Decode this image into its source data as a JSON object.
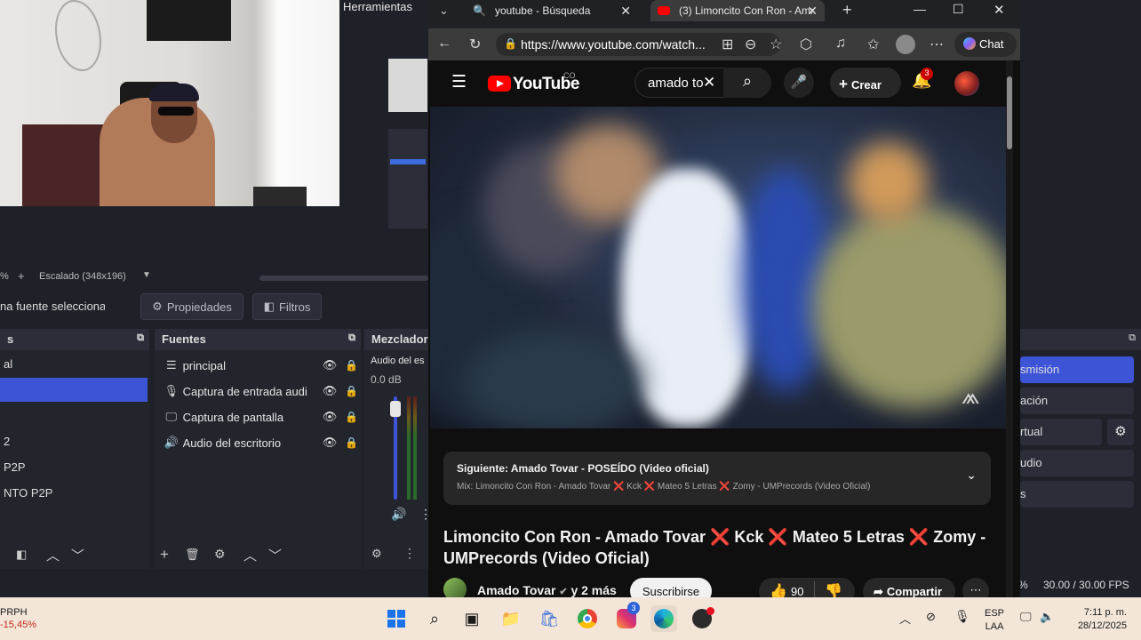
{
  "obs": {
    "menu_tools": "Herramientas",
    "scale_label": "Escalado (348x196)",
    "no_source_selected": "na fuente seleccionad",
    "properties_label": "Propiedades",
    "filters_label": "Filtros",
    "scenes_header": "s",
    "scenes": [
      {
        "label": "al",
        "selected": false
      },
      {
        "label": "",
        "selected": true
      },
      {
        "label": "",
        "selected": false
      },
      {
        "label": "2",
        "selected": false
      },
      {
        "label": "P2P",
        "selected": false
      },
      {
        "label": "NTO P2P",
        "selected": false
      }
    ],
    "sources_header": "Fuentes",
    "sources": [
      {
        "label": "principal",
        "icon": "list-icon"
      },
      {
        "label": "Captura de entrada audi",
        "icon": "microphone-icon"
      },
      {
        "label": "Captura de pantalla",
        "icon": "monitor-icon"
      },
      {
        "label": "Audio del escritorio",
        "icon": "speaker-icon"
      }
    ],
    "mixer_header": "Mezclador",
    "mixer_channel": "Audio del es",
    "mixer_db": "0.0 dB",
    "mixer_level": 0.12,
    "controls": [
      {
        "label": "smisión",
        "highlight": true
      },
      {
        "label": "ación",
        "highlight": false
      },
      {
        "label": "rtual",
        "highlight": false
      },
      {
        "label": "udio",
        "highlight": false
      },
      {
        "label": "s",
        "highlight": false
      }
    ],
    "status_percent": "%",
    "fps": "30.00 / 30.00 FPS"
  },
  "browser": {
    "tabs": [
      {
        "label": "youtube - Búsqueda",
        "active": false
      },
      {
        "label": "(3) Limoncito Con Ron - Ama",
        "active": true
      }
    ],
    "url": "https://www.youtube.com/watch...",
    "chat_label": "Chat"
  },
  "youtube": {
    "logo_text": "YouTube",
    "country_code": "CO",
    "search_value": "amado to",
    "create_label": "Crear",
    "notification_count": "3",
    "up_next_title": "Siguiente: Amado Tovar - POSEÍDO (Video oficial)",
    "up_next_mix": "Mix: Limoncito Con Ron - Amado Tovar ❌ Kck ❌ Mateo 5 Letras ❌ Zomy - UMPrecords (Video Oficial)",
    "video_title": "Limoncito Con Ron - Amado Tovar ❌ Kck ❌ Mateo 5 Letras ❌ Zomy - UMPrecords (Video Oficial)",
    "channel_name": "Amado Tovar",
    "channel_suffix": "y 2 más",
    "subscribe_label": "Suscribirse",
    "likes": "90",
    "share_label": "Compartir"
  },
  "taskbar": {
    "ticker_name": "PRPH",
    "ticker_change": "-15,45%",
    "language_top": "ESP",
    "language_bottom": "LAA",
    "time": "7:11 p. m.",
    "date": "28/12/2025",
    "instagram_badge": "3"
  },
  "colors": {
    "obs_bg": "#1f2129",
    "obs_accent": "#3d54d6",
    "youtube_red": "#ff0000",
    "taskbar": "#f3e6d9"
  }
}
